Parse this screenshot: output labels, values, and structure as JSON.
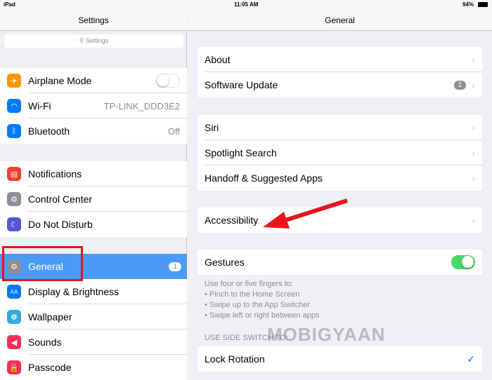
{
  "status": {
    "device": "iPad",
    "time": "11:05 AM",
    "battery": "94%"
  },
  "left": {
    "title": "Settings",
    "search_placeholder": "Settings",
    "groups": [
      [
        {
          "label": "Airplane Mode",
          "icon": "airplane-icon",
          "color": "#ff9500",
          "toggle": false
        },
        {
          "label": "Wi-Fi",
          "icon": "wifi-icon",
          "color": "#007aff",
          "value": "TP-LINK_DDD3E2"
        },
        {
          "label": "Bluetooth",
          "icon": "bluetooth-icon",
          "color": "#007aff",
          "value": "Off"
        }
      ],
      [
        {
          "label": "Notifications",
          "icon": "notifications-icon",
          "color": "#ff3b30"
        },
        {
          "label": "Control Center",
          "icon": "control-center-icon",
          "color": "#8e8e93"
        },
        {
          "label": "Do Not Disturb",
          "icon": "moon-icon",
          "color": "#5856d6"
        }
      ],
      [
        {
          "label": "General",
          "icon": "gear-icon",
          "color": "#8e8e93",
          "badge": "1",
          "selected": true
        },
        {
          "label": "Display & Brightness",
          "icon": "display-icon",
          "color": "#007aff"
        },
        {
          "label": "Wallpaper",
          "icon": "wallpaper-icon",
          "color": "#34aadc"
        },
        {
          "label": "Sounds",
          "icon": "sounds-icon",
          "color": "#ff2d55"
        },
        {
          "label": "Passcode",
          "icon": "passcode-icon",
          "color": "#ff2d55"
        }
      ]
    ]
  },
  "right": {
    "title": "General",
    "groups": [
      [
        {
          "label": "About"
        },
        {
          "label": "Software Update",
          "badge": "1"
        }
      ],
      [
        {
          "label": "Siri"
        },
        {
          "label": "Spotlight Search"
        },
        {
          "label": "Handoff & Suggested Apps"
        }
      ],
      [
        {
          "label": "Accessibility"
        }
      ],
      [
        {
          "label": "Gestures",
          "toggle": true
        }
      ]
    ],
    "gestures_note": [
      "Use four or five fingers to:",
      "• Pinch to the Home Screen",
      "• Swipe up to the App Switcher",
      "• Swipe left or right between apps"
    ],
    "side_switch_header": "USE SIDE SWITCH TO:",
    "lock_rotation": "Lock Rotation"
  },
  "watermark": "MOBIGYAAN",
  "colors": {
    "selected": "#4a9bf5",
    "annotation": "#e8141c",
    "toggle_on": "#4cd964"
  }
}
